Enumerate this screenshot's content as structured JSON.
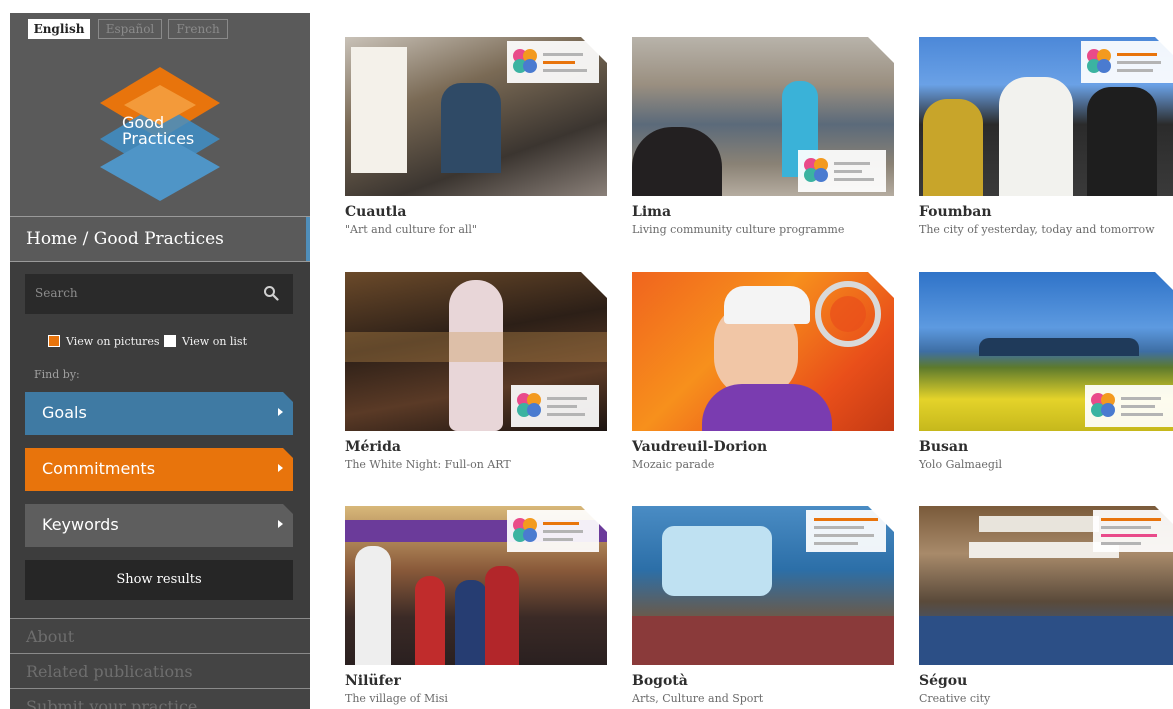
{
  "languages": [
    {
      "label": "English",
      "active": true
    },
    {
      "label": "Español",
      "active": false
    },
    {
      "label": "French",
      "active": false
    }
  ],
  "logo": {
    "line1": "Good",
    "line2": "Practices"
  },
  "breadcrumb": "Home / Good Practices",
  "search": {
    "placeholder": "Search"
  },
  "view_options": {
    "pictures": "View on pictures",
    "pictures_checked": true,
    "list": "View on list",
    "list_checked": false
  },
  "find_by": "Find by:",
  "filters": [
    {
      "label": "Goals",
      "color": "#3f7aa3"
    },
    {
      "label": "Commitments",
      "color": "#e8740c"
    },
    {
      "label": "Keywords",
      "color": "#5e5e5e"
    }
  ],
  "show_results": "Show results",
  "nav_links": [
    "About",
    "Related publications",
    "Submit your practice"
  ],
  "practices": [
    {
      "city": "Cuautla",
      "subtitle": "\"Art and culture for all\""
    },
    {
      "city": "Lima",
      "subtitle": "Living community culture programme"
    },
    {
      "city": "Foumban",
      "subtitle": "The city of yesterday, today and tomorrow"
    },
    {
      "city": "Mérida",
      "subtitle": "The White Night: Full-on ART"
    },
    {
      "city": "Vaudreuil-Dorion",
      "subtitle": "Mozaic parade"
    },
    {
      "city": "Busan",
      "subtitle": "Yolo Galmaegil"
    },
    {
      "city": "Nilüfer",
      "subtitle": "The village of Misi"
    },
    {
      "city": "Bogotà",
      "subtitle": "Arts, Culture and Sport"
    },
    {
      "city": "Ségou",
      "subtitle": "Creative city"
    }
  ]
}
